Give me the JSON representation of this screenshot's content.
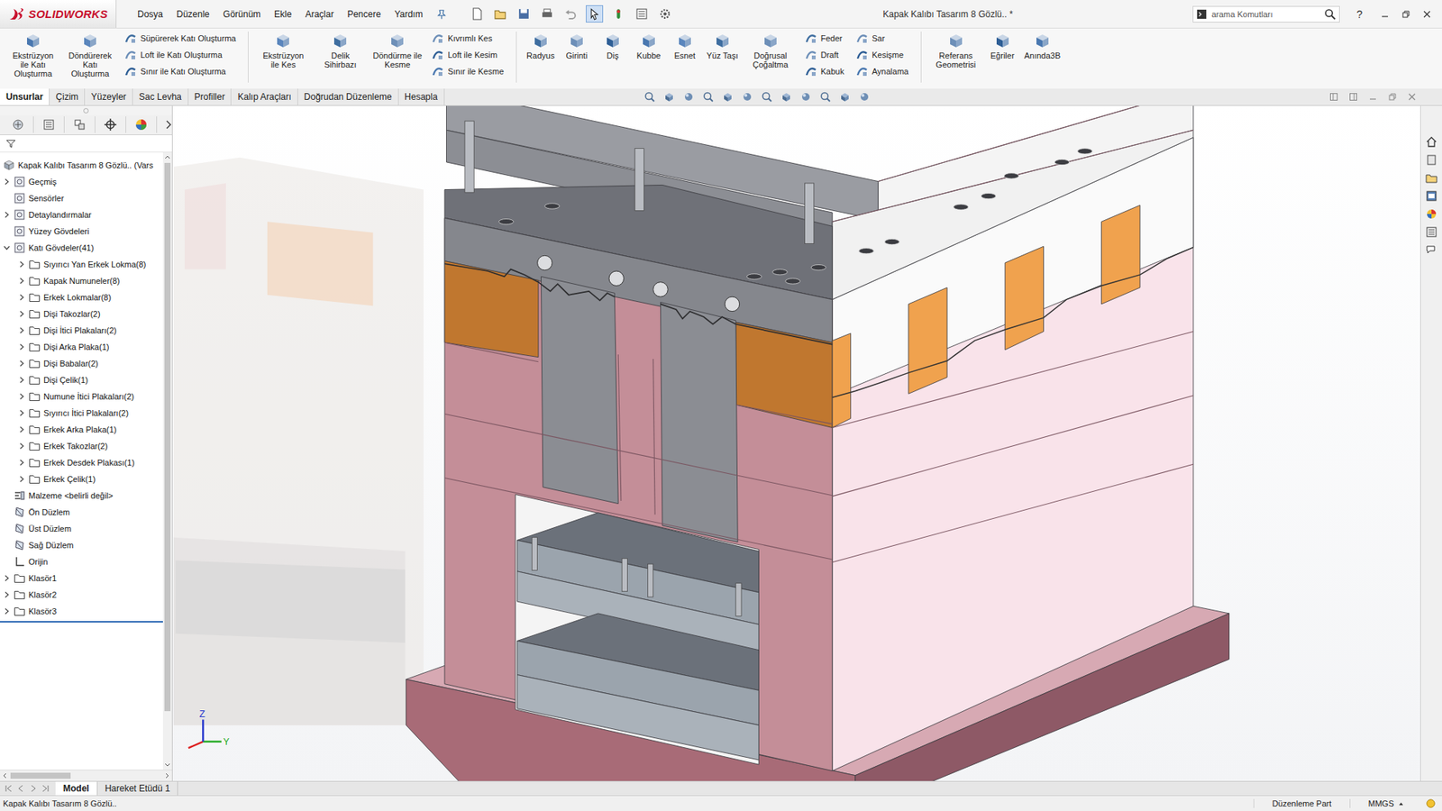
{
  "window": {
    "app": "SOLIDWORKS",
    "title": "Kapak Kalıbı Tasarım 8 Gözlü.. *"
  },
  "menu": [
    "Dosya",
    "Düzenle",
    "Görünüm",
    "Ekle",
    "Araçlar",
    "Pencere",
    "Yardım"
  ],
  "search": {
    "placeholder": "arama Komutları"
  },
  "help": "?",
  "ribbon": [
    [
      {
        "kind": "large",
        "label": "Ekstrüzyon ile Katı Oluşturma"
      },
      {
        "kind": "large",
        "label": "Döndürerek Katı Oluşturma"
      },
      {
        "kind": "stack",
        "items": [
          "Süpürerek Katı Oluşturma",
          "Loft ile Katı Oluşturma",
          "Sınır ile Katı Oluşturma"
        ]
      }
    ],
    [
      {
        "kind": "large",
        "label": "Ekstrüzyon ile Kes"
      },
      {
        "kind": "large",
        "label": "Delik Sihirbazı"
      },
      {
        "kind": "large",
        "label": "Döndürme ile Kesme"
      },
      {
        "kind": "stack",
        "items": [
          "Kıvrımlı Kes",
          "Loft ile Kesim",
          "Sınır ile Kesme"
        ]
      }
    ],
    [
      {
        "kind": "large",
        "label": "Radyus"
      },
      {
        "kind": "large",
        "label": "Girinti"
      },
      {
        "kind": "large",
        "label": "Diş"
      },
      {
        "kind": "large",
        "label": "Kubbe"
      },
      {
        "kind": "large",
        "label": "Esnet"
      },
      {
        "kind": "large",
        "label": "Yüz Taşı"
      },
      {
        "kind": "large",
        "label": "Doğrusal Çoğaltma"
      },
      {
        "kind": "stack",
        "items": [
          "Feder",
          "Draft",
          "Kabuk"
        ]
      },
      {
        "kind": "stack",
        "items": [
          "Sar",
          "Kesişme",
          "Aynalama"
        ]
      }
    ],
    [
      {
        "kind": "large",
        "label": "Referans Geometrisi"
      },
      {
        "kind": "large",
        "label": "Eğriler"
      },
      {
        "kind": "large",
        "label": "Anında3B"
      }
    ]
  ],
  "tabs": [
    {
      "label": "Unsurlar",
      "selected": true
    },
    {
      "label": "Çizim",
      "selected": false
    },
    {
      "label": "Yüzeyler",
      "selected": false
    },
    {
      "label": "Sac Levha",
      "selected": false
    },
    {
      "label": "Profiller",
      "selected": false
    },
    {
      "label": "Kalıp Araçları",
      "selected": false
    },
    {
      "label": "Doğrudan Düzenleme",
      "selected": false
    },
    {
      "label": "Hesapla",
      "selected": false
    }
  ],
  "tree": [
    {
      "label": "Kapak Kalıbı Tasarım 8 Gözlü.. (Vars",
      "depth": 0,
      "kind": "part",
      "expandable": false,
      "expanded": false
    },
    {
      "label": "Geçmiş",
      "depth": 0,
      "kind": "node",
      "expandable": true,
      "expanded": false
    },
    {
      "label": "Sensörler",
      "depth": 0,
      "kind": "node",
      "expandable": false,
      "expanded": false
    },
    {
      "label": "Detaylandırmalar",
      "depth": 0,
      "kind": "node",
      "expandable": true,
      "expanded": false
    },
    {
      "label": "Yüzey Gövdeleri",
      "depth": 0,
      "kind": "node",
      "expandable": false,
      "expanded": false
    },
    {
      "label": "Katı Gövdeler(41)",
      "depth": 0,
      "kind": "node",
      "expandable": true,
      "expanded": true
    },
    {
      "label": "Sıyırıcı Yan Erkek Lokma(8)",
      "depth": 1,
      "kind": "folder",
      "expandable": true,
      "expanded": false
    },
    {
      "label": "Kapak Numuneler(8)",
      "depth": 1,
      "kind": "folder",
      "expandable": true,
      "expanded": false
    },
    {
      "label": "Erkek Lokmalar(8)",
      "depth": 1,
      "kind": "folder",
      "expandable": true,
      "expanded": false
    },
    {
      "label": "Dişi Takozlar(2)",
      "depth": 1,
      "kind": "folder",
      "expandable": true,
      "expanded": false
    },
    {
      "label": "Dişi İtici Plakaları(2)",
      "depth": 1,
      "kind": "folder",
      "expandable": true,
      "expanded": false
    },
    {
      "label": "Dişi Arka Plaka(1)",
      "depth": 1,
      "kind": "folder",
      "expandable": true,
      "expanded": false
    },
    {
      "label": "Dişi Babalar(2)",
      "depth": 1,
      "kind": "folder",
      "expandable": true,
      "expanded": false
    },
    {
      "label": "Dişi Çelik(1)",
      "depth": 1,
      "kind": "folder",
      "expandable": true,
      "expanded": false
    },
    {
      "label": "Numune İtici Plakaları(2)",
      "depth": 1,
      "kind": "folder",
      "expandable": true,
      "expanded": false
    },
    {
      "label": "Sıyırıcı İtici Plakaları(2)",
      "depth": 1,
      "kind": "folder",
      "expandable": true,
      "expanded": false
    },
    {
      "label": "Erkek Arka Plaka(1)",
      "depth": 1,
      "kind": "folder",
      "expandable": true,
      "expanded": false
    },
    {
      "label": "Erkek Takozlar(2)",
      "depth": 1,
      "kind": "folder",
      "expandable": true,
      "expanded": false
    },
    {
      "label": "Erkek Desdek Plakası(1)",
      "depth": 1,
      "kind": "folder",
      "expandable": true,
      "expanded": false
    },
    {
      "label": "Erkek Çelik(1)",
      "depth": 1,
      "kind": "folder",
      "expandable": true,
      "expanded": false
    },
    {
      "label": "Malzeme <belirli değil>",
      "depth": 0,
      "kind": "material",
      "expandable": false,
      "expanded": false
    },
    {
      "label": "Ön Düzlem",
      "depth": 0,
      "kind": "plane",
      "expandable": false,
      "expanded": false
    },
    {
      "label": "Üst Düzlem",
      "depth": 0,
      "kind": "plane",
      "expandable": false,
      "expanded": false
    },
    {
      "label": "Sağ Düzlem",
      "depth": 0,
      "kind": "plane",
      "expandable": false,
      "expanded": false
    },
    {
      "label": "Orijin",
      "depth": 0,
      "kind": "origin",
      "expandable": false,
      "expanded": false
    },
    {
      "label": "Klasör1",
      "depth": 0,
      "kind": "folder",
      "expandable": true,
      "expanded": false
    },
    {
      "label": "Klasör2",
      "depth": 0,
      "kind": "folder",
      "expandable": true,
      "expanded": false
    },
    {
      "label": "Klasör3",
      "depth": 0,
      "kind": "folder",
      "expandable": true,
      "expanded": false
    }
  ],
  "triad": {
    "z": "Z",
    "y": "Y"
  },
  "model_tabs": [
    {
      "label": "Model",
      "selected": true
    },
    {
      "label": "Hareket Etüdü 1",
      "selected": false
    }
  ],
  "status_bar": {
    "document": "Kapak Kalıbı Tasarım 8 Gözlü..",
    "mode": "Düzenleme Part",
    "units": "MMGS"
  }
}
